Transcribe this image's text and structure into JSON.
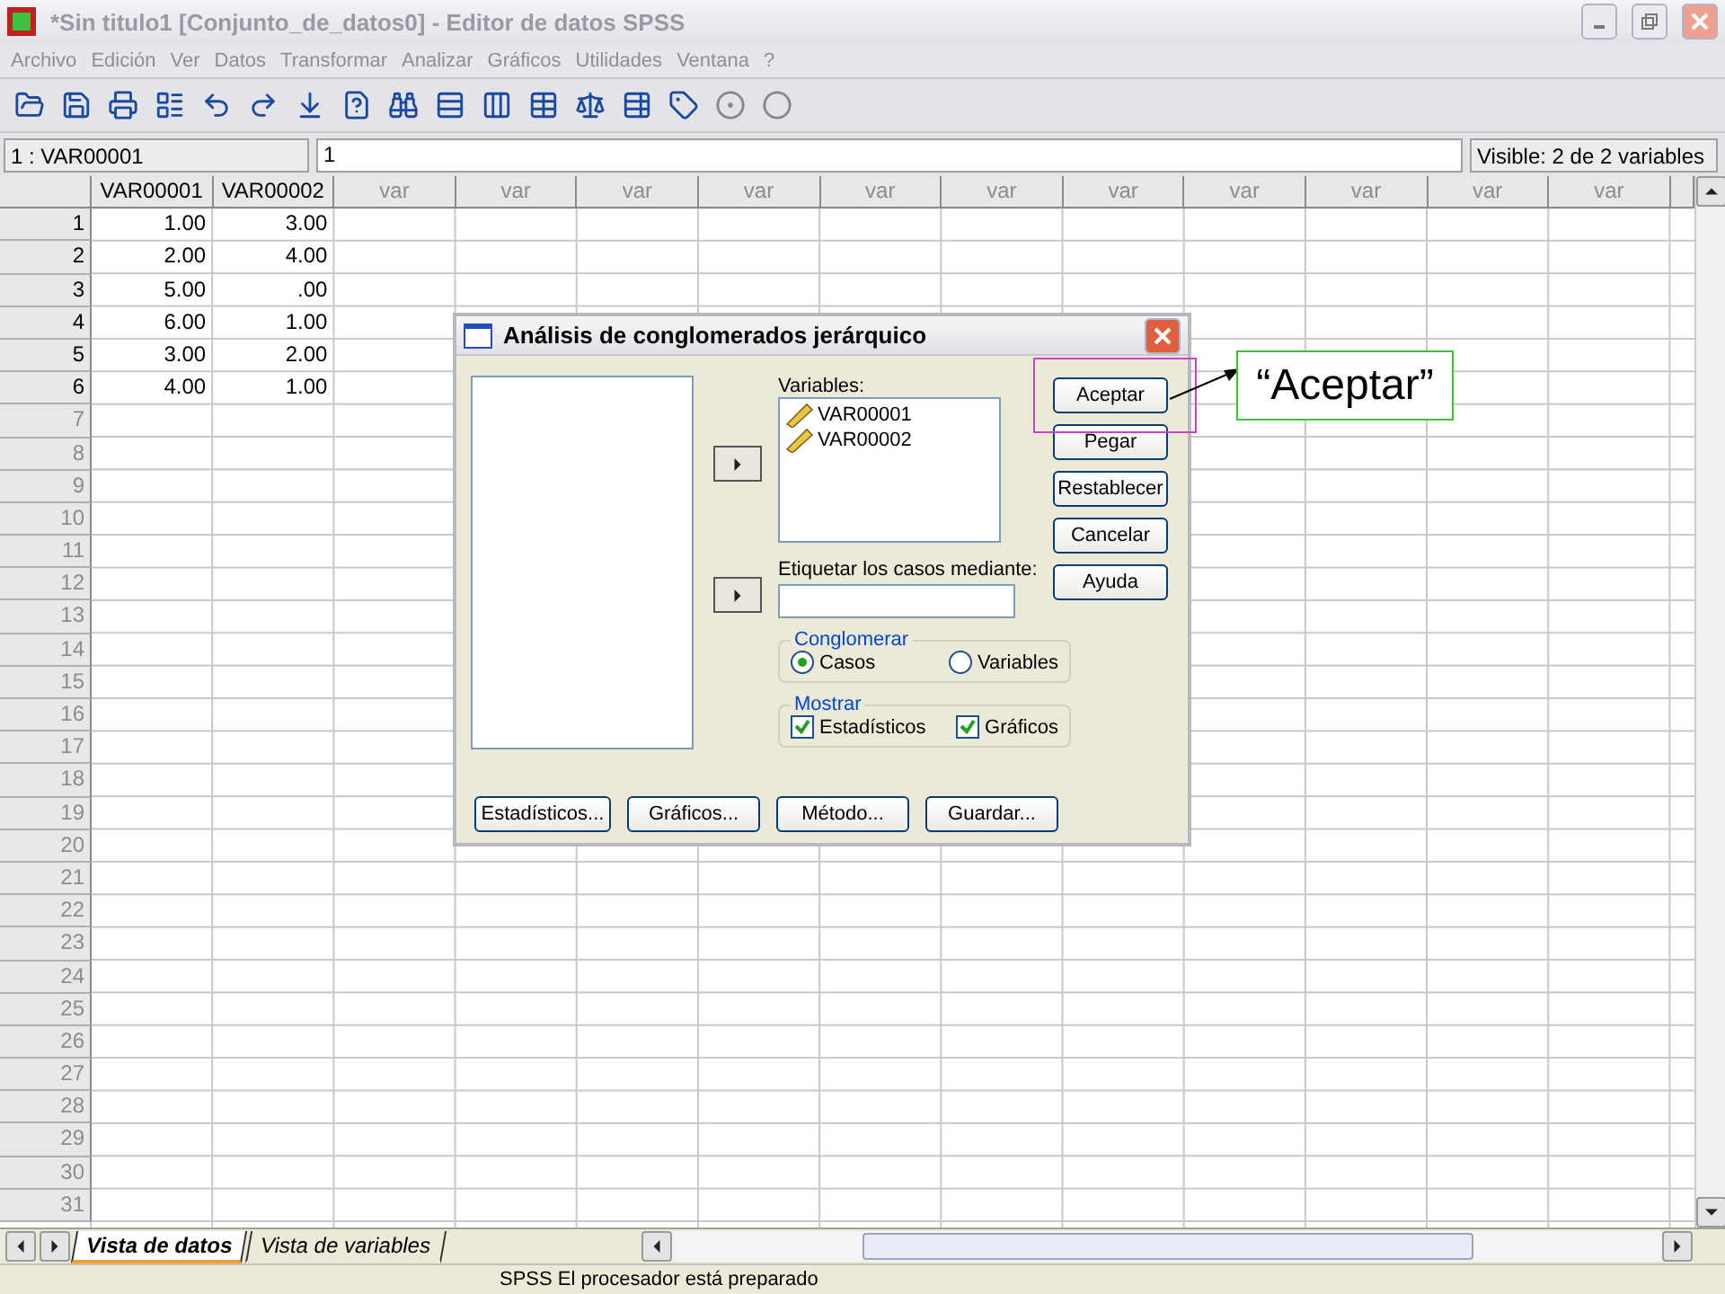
{
  "window": {
    "title": "*Sin titulo1 [Conjunto_de_datos0] - Editor de datos SPSS"
  },
  "menu": [
    "Archivo",
    "Edición",
    "Ver",
    "Datos",
    "Transformar",
    "Analizar",
    "Gráficos",
    "Utilidades",
    "Ventana",
    "?"
  ],
  "cell_editor": {
    "cell_ref": "1 : VAR00001",
    "value": "1",
    "visible": "Visible: 2 de 2 variables"
  },
  "grid": {
    "columns": [
      {
        "label": "VAR00001",
        "defined": true
      },
      {
        "label": "VAR00002",
        "defined": true
      },
      {
        "label": "var",
        "defined": false
      },
      {
        "label": "var",
        "defined": false
      },
      {
        "label": "var",
        "defined": false
      },
      {
        "label": "var",
        "defined": false
      },
      {
        "label": "var",
        "defined": false
      },
      {
        "label": "var",
        "defined": false
      },
      {
        "label": "var",
        "defined": false
      },
      {
        "label": "var",
        "defined": false
      },
      {
        "label": "var",
        "defined": false
      },
      {
        "label": "var",
        "defined": false
      },
      {
        "label": "var",
        "defined": false
      }
    ],
    "rows": [
      {
        "number": "1",
        "defined": true,
        "values": [
          "1.00",
          "3.00"
        ]
      },
      {
        "number": "2",
        "defined": true,
        "values": [
          "2.00",
          "4.00"
        ]
      },
      {
        "number": "3",
        "defined": true,
        "values": [
          "5.00",
          ".00"
        ]
      },
      {
        "number": "4",
        "defined": true,
        "values": [
          "6.00",
          "1.00"
        ]
      },
      {
        "number": "5",
        "defined": true,
        "values": [
          "3.00",
          "2.00"
        ]
      },
      {
        "number": "6",
        "defined": true,
        "values": [
          "4.00",
          "1.00"
        ]
      },
      {
        "number": "7",
        "defined": false
      },
      {
        "number": "8",
        "defined": false
      },
      {
        "number": "9",
        "defined": false
      },
      {
        "number": "10",
        "defined": false
      },
      {
        "number": "11",
        "defined": false
      },
      {
        "number": "12",
        "defined": false
      },
      {
        "number": "13",
        "defined": false
      },
      {
        "number": "14",
        "defined": false
      },
      {
        "number": "15",
        "defined": false
      },
      {
        "number": "16",
        "defined": false
      },
      {
        "number": "17",
        "defined": false
      },
      {
        "number": "18",
        "defined": false
      },
      {
        "number": "19",
        "defined": false
      },
      {
        "number": "20",
        "defined": false
      },
      {
        "number": "21",
        "defined": false
      },
      {
        "number": "22",
        "defined": false
      },
      {
        "number": "23",
        "defined": false
      },
      {
        "number": "24",
        "defined": false
      },
      {
        "number": "25",
        "defined": false
      },
      {
        "number": "26",
        "defined": false
      },
      {
        "number": "27",
        "defined": false
      },
      {
        "number": "28",
        "defined": false
      },
      {
        "number": "29",
        "defined": false
      },
      {
        "number": "30",
        "defined": false
      },
      {
        "number": "31",
        "defined": false
      }
    ]
  },
  "sheet_tabs": [
    {
      "label": "Vista de datos",
      "selected": true
    },
    {
      "label": "Vista de variables",
      "selected": false
    }
  ],
  "status_bar": "SPSS El procesador  está preparado",
  "dialog": {
    "title": "Análisis de conglomerados jerárquico",
    "variables_label": "Variables:",
    "variables": [
      "VAR00001",
      "VAR00002"
    ],
    "label_cases_label": "Etiquetar los casos mediante:",
    "cluster_group": {
      "title": "Conglomerar",
      "options": [
        {
          "label": "Casos",
          "selected": true
        },
        {
          "label": "Variables",
          "selected": false
        }
      ]
    },
    "display_group": {
      "title": "Mostrar",
      "options": [
        {
          "label": "Estadísticos",
          "checked": true
        },
        {
          "label": "Gráficos",
          "checked": true
        }
      ]
    },
    "side_buttons": [
      "Aceptar",
      "Pegar",
      "Restablecer",
      "Cancelar",
      "Ayuda"
    ],
    "bottom_buttons": [
      "Estadísticos...",
      "Gráficos...",
      "Método...",
      "Guardar..."
    ]
  },
  "callout": {
    "text": "“Aceptar”"
  }
}
